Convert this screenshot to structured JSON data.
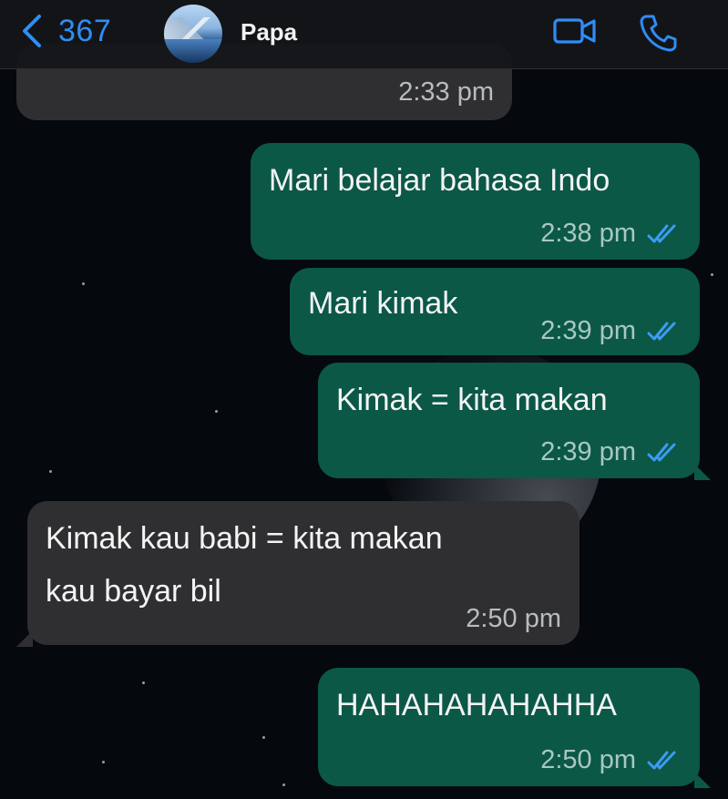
{
  "header": {
    "back_count": "367",
    "contact_name": "Papa"
  },
  "colors": {
    "accent": "#2f8df5",
    "incoming_bubble": "#2f2f32",
    "outgoing_bubble": "#0b5847",
    "read_ticks": "#3c9bf2"
  },
  "icons": {
    "back": "chevron-left-icon",
    "video": "video-camera-icon",
    "phone": "phone-icon",
    "read": "double-check-icon"
  },
  "messages": [
    {
      "direction": "in",
      "text": "",
      "time": "2:33 pm"
    },
    {
      "direction": "out",
      "text": "Mari belajar bahasa Indo",
      "time": "2:38 pm",
      "status": "read"
    },
    {
      "direction": "out",
      "text": "Mari kimak",
      "time": "2:39 pm",
      "status": "read"
    },
    {
      "direction": "out",
      "text": "Kimak = kita makan",
      "time": "2:39 pm",
      "status": "read"
    },
    {
      "direction": "in",
      "lines": [
        "Kimak kau babi = kita makan",
        "kau bayar bil"
      ],
      "time": "2:50 pm"
    },
    {
      "direction": "out",
      "text": "HAHAHAHAHAHHA",
      "time": "2:50 pm",
      "status": "read"
    }
  ]
}
